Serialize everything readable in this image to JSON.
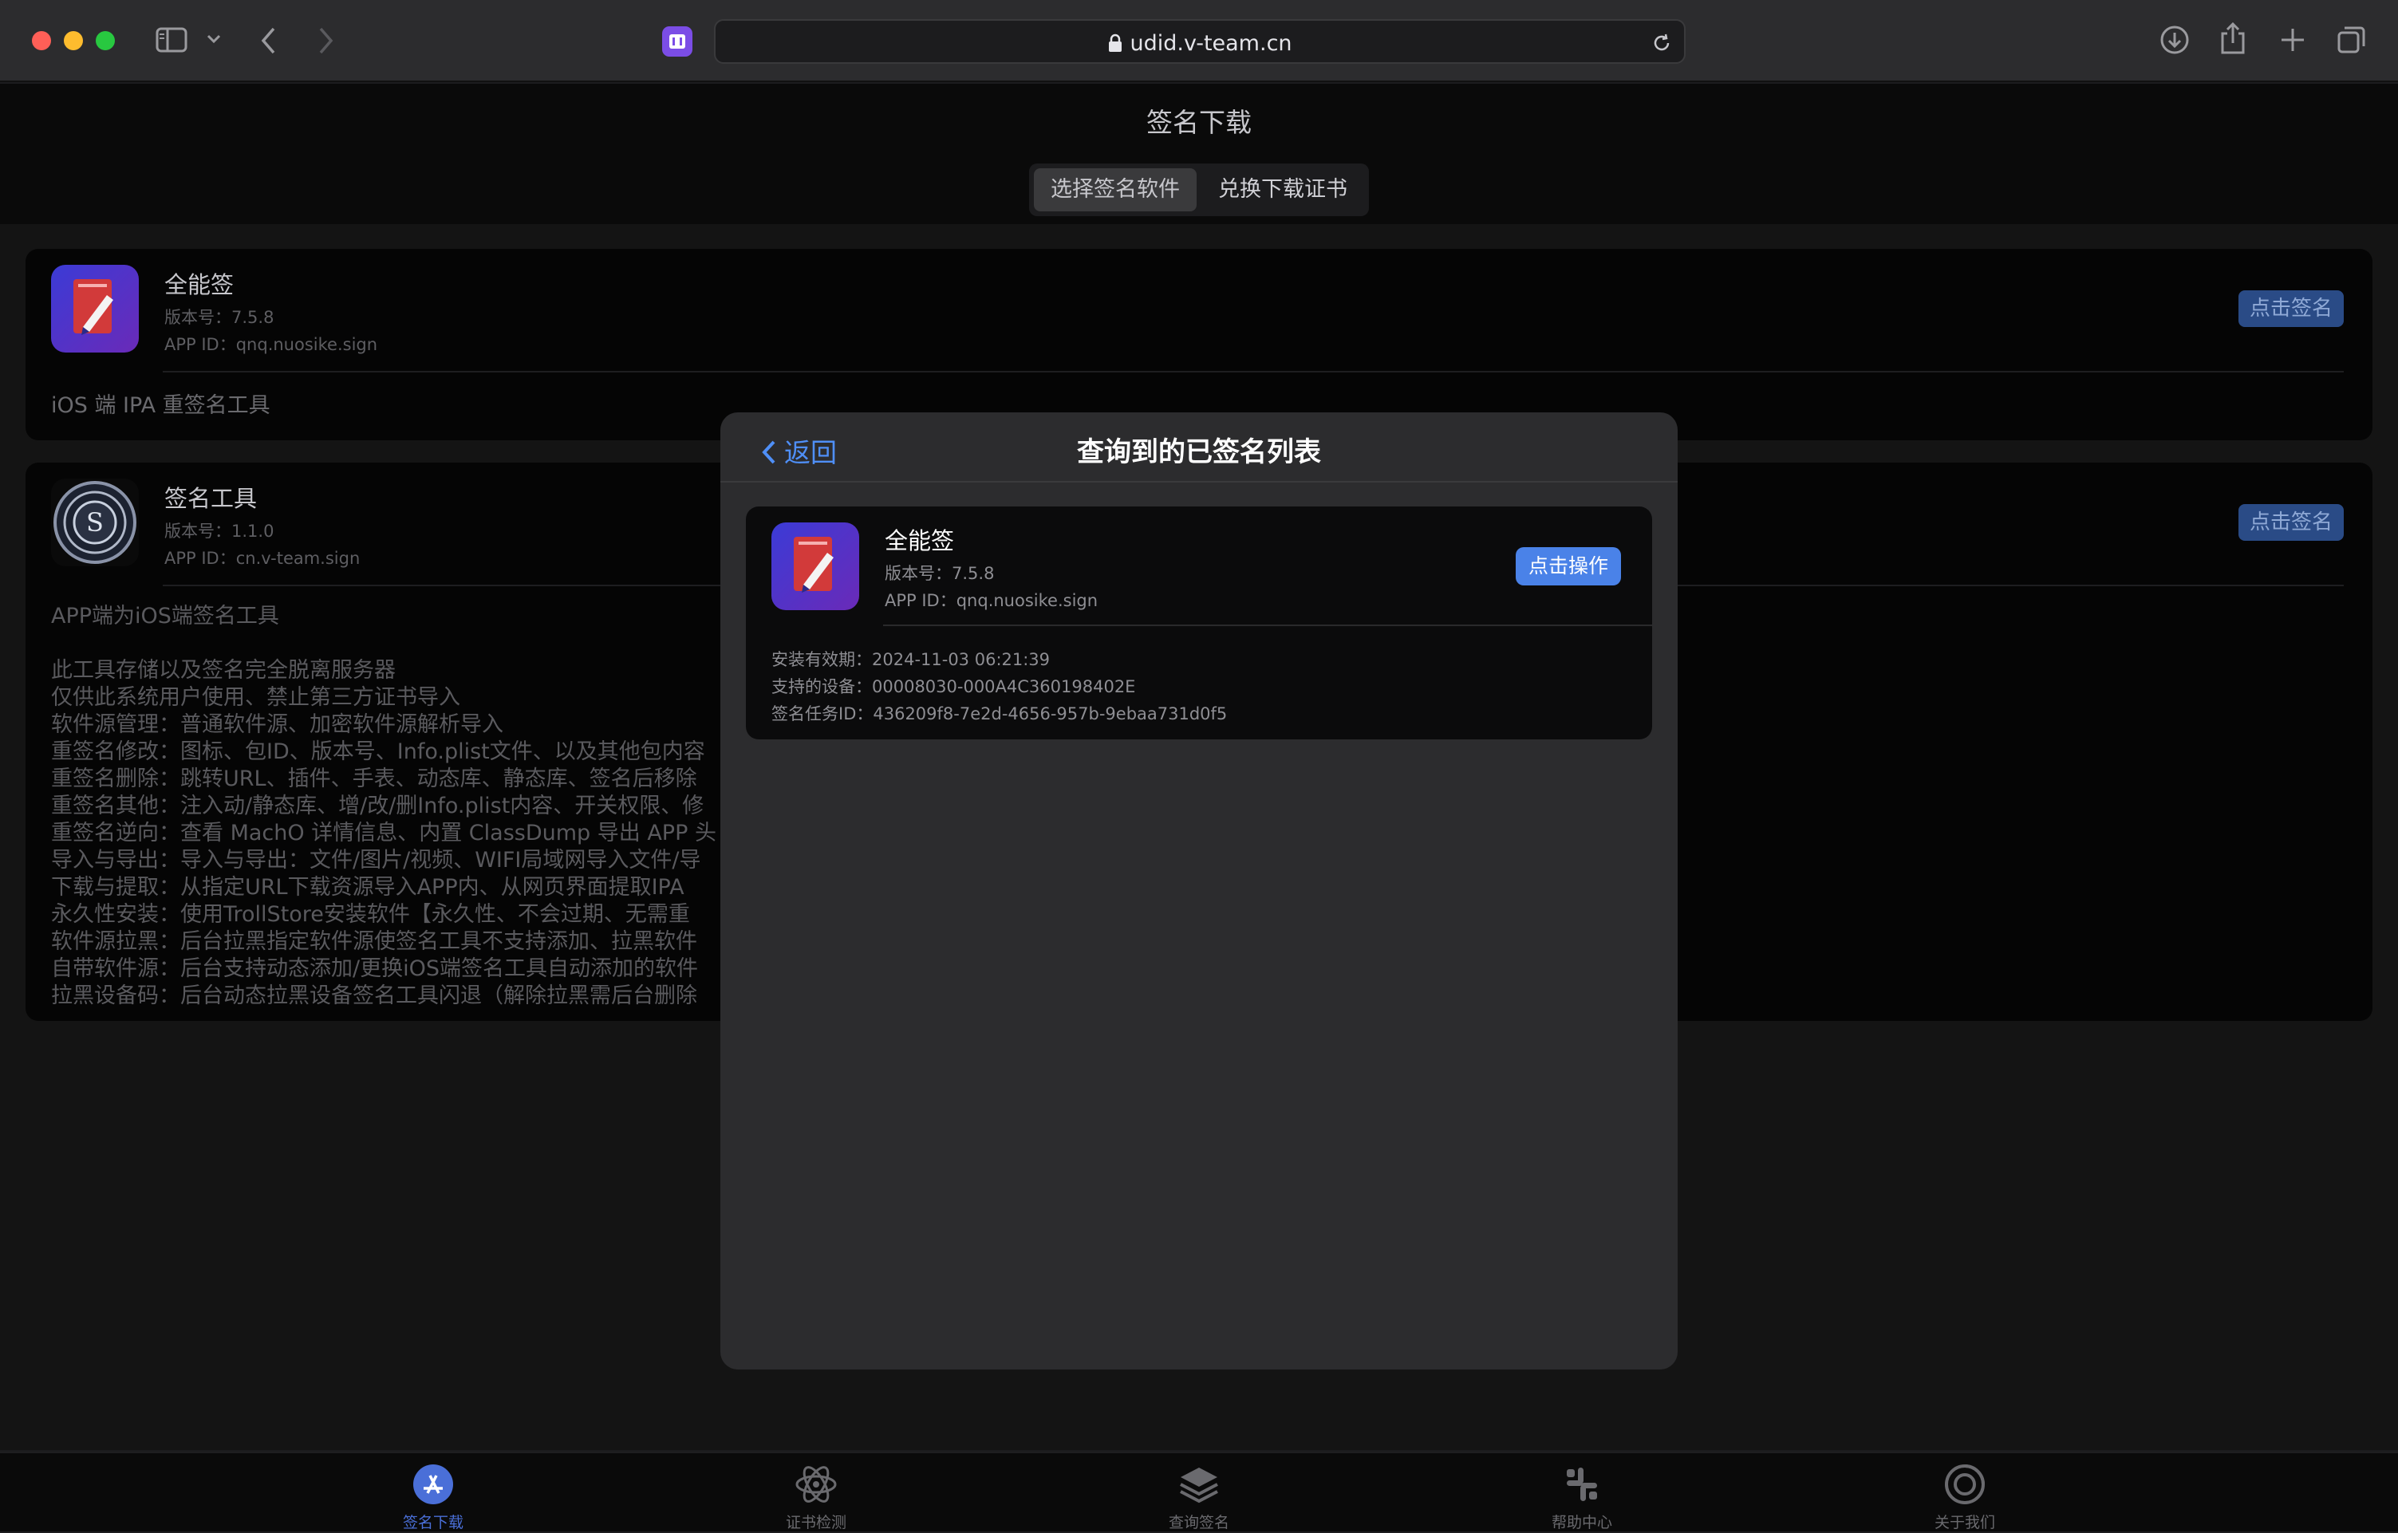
{
  "browser": {
    "url": "udid.v-team.cn"
  },
  "page": {
    "title": "签名下载",
    "segments": [
      "选择签名软件",
      "兑换下载证书"
    ]
  },
  "apps": [
    {
      "name": "全能签",
      "version_label": "版本号：7.5.8",
      "appid_label": "APP ID：qnq.nuosike.sign",
      "button": "点击签名",
      "description": "iOS 端 IPA 重签名工具"
    },
    {
      "name": "签名工具",
      "version_label": "版本号：1.1.0",
      "appid_label": "APP ID：cn.v-team.sign",
      "button": "点击签名",
      "description_lines": [
        "APP端为iOS端签名工具",
        "",
        "此工具存储以及签名完全脱离服务器",
        "仅供此系统用户使用、禁止第三方证书导入",
        "软件源管理：普通软件源、加密软件源解析导入",
        "重签名修改：图标、包ID、版本号、Info.plist文件、以及其他包内容",
        "重签名删除：跳转URL、插件、手表、动态库、静态库、签名后移除",
        "重签名其他：注入动/静态库、增/改/删Info.plist内容、开关权限、修",
        "重签名逆向：查看 MachO 详情信息、内置 ClassDump 导出 APP 头",
        "导入与导出：导入与导出：文件/图片/视频、WIFI局域网导入文件/导",
        "下载与提取：从指定URL下载资源导入APP内、从网页界面提取IPA",
        "永久性安装：使用TrollStore安装软件【永久性、不会过期、无需重",
        "软件源拉黑：后台拉黑指定软件源使签名工具不支持添加、拉黑软件",
        "自带软件源：后台支持动态添加/更换iOS端签名工具自动添加的软件",
        "拉黑设备码：后台动态拉黑设备签名工具闪退（解除拉黑需后台删除"
      ]
    }
  ],
  "modal": {
    "back_label": "返回",
    "title": "查询到的已签名列表",
    "record": {
      "name": "全能签",
      "version_label": "版本号：7.5.8",
      "appid_label": "APP ID：qnq.nuosike.sign",
      "button": "点击操作",
      "expiry": "安装有效期：2024-11-03 06:21:39",
      "device": "支持的设备：00008030-000A4C360198402E",
      "task_id": "签名任务ID：436209f8-7e2d-4656-957b-9ebaa731d0f5"
    }
  },
  "tabbar": {
    "items": [
      {
        "label": "签名下载",
        "icon": "app-store-icon",
        "active": true
      },
      {
        "label": "证书检测",
        "icon": "atom-icon",
        "active": false
      },
      {
        "label": "查询签名",
        "icon": "layers-icon",
        "active": false
      },
      {
        "label": "帮助中心",
        "icon": "slack-icon",
        "active": false
      },
      {
        "label": "关于我们",
        "icon": "target-icon",
        "active": false
      }
    ]
  },
  "colors": {
    "accent": "#4a82e8",
    "tab_active": "#4a6fd8"
  }
}
